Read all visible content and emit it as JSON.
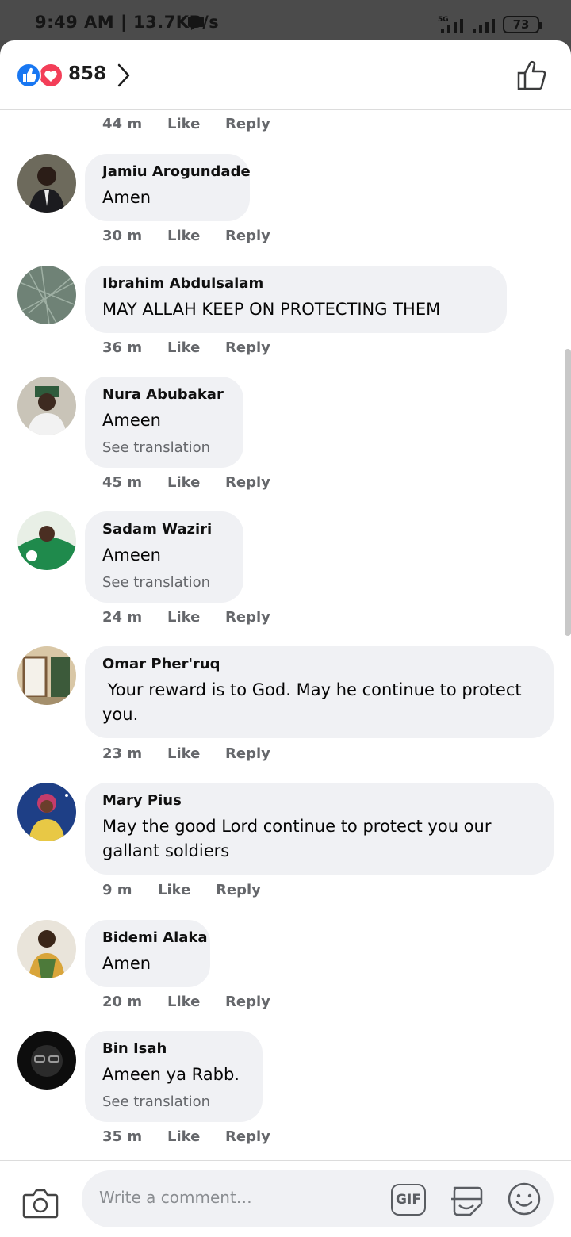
{
  "status_bar": {
    "time": "9:49 AM | 13.7KB/s",
    "network": "5G",
    "battery": "73"
  },
  "header": {
    "reaction_count": "858",
    "reactions": [
      "like-icon",
      "love-icon"
    ]
  },
  "comments": [
    {
      "name": "",
      "text": "",
      "translation": "",
      "time": "44 m",
      "like": "Like",
      "reply": "Reply"
    },
    {
      "name": "Jamiu Arogundade",
      "text": "Amen",
      "translation": "",
      "time": "30 m",
      "like": "Like",
      "reply": "Reply"
    },
    {
      "name": "Ibrahim Abdulsalam",
      "text": "MAY ALLAH KEEP ON PROTECTING THEM",
      "translation": "",
      "time": "36 m",
      "like": "Like",
      "reply": "Reply"
    },
    {
      "name": "Nura Abubakar",
      "text": "Ameen",
      "translation": "See translation",
      "time": "45 m",
      "like": "Like",
      "reply": "Reply"
    },
    {
      "name": "Sadam Waziri",
      "text": "Ameen",
      "translation": "See translation",
      "time": "24 m",
      "like": "Like",
      "reply": "Reply"
    },
    {
      "name": "Omar Pher'ruq",
      "text": " Your reward is to God. May he continue to protect you.",
      "translation": "",
      "time": "23 m",
      "like": "Like",
      "reply": "Reply"
    },
    {
      "name": "Mary Pius",
      "text": "May the good Lord continue to protect you our gallant soldiers",
      "translation": "",
      "time": "9 m",
      "like": "Like",
      "reply": "Reply"
    },
    {
      "name": "Bidemi Alaka",
      "text": "Amen",
      "translation": "",
      "time": "20 m",
      "like": "Like",
      "reply": "Reply"
    },
    {
      "name": "Bin Isah",
      "text": "Ameen ya Rabb.",
      "translation": "See translation",
      "time": "35 m",
      "like": "Like",
      "reply": "Reply"
    }
  ],
  "composer": {
    "placeholder": "Write a comment…",
    "gif_label": "GIF"
  },
  "colors": {
    "like_blue": "#1877f2",
    "love_red": "#f33e58",
    "bubble_bg": "#f0f1f4",
    "meta_gray": "#65676b"
  }
}
